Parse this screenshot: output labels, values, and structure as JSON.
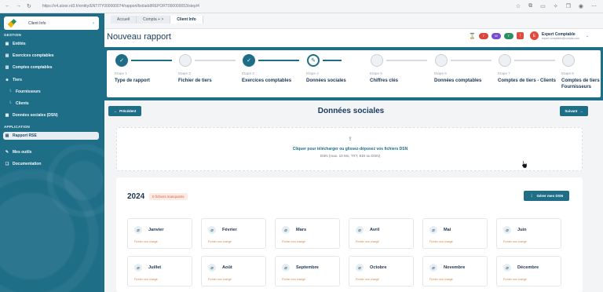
{
  "browser": {
    "url": "https://v4.atoor.rd3.fr/entity/ENTITY000000074/rapport/list/add/REPORT000000053/step/4"
  },
  "sidebar": {
    "client_label": "Client Info",
    "section_gestion": "GESTION",
    "items": [
      {
        "label": "Entités",
        "icon": "building-icon"
      },
      {
        "label": "Exercices comptables",
        "icon": "calendar-icon"
      },
      {
        "label": "Comptes comptables",
        "icon": "ledger-icon"
      },
      {
        "label": "Tiers",
        "icon": "users-icon"
      },
      {
        "label": "Fournisseurs",
        "icon": "corner-icon"
      },
      {
        "label": "Clients",
        "icon": "corner-icon"
      },
      {
        "label": "Données sociales (DSN)",
        "icon": "document-icon"
      }
    ],
    "section_application": "APPLICATION",
    "app_items": [
      {
        "label": "Rapport RSE",
        "icon": "report-icon",
        "active": true
      },
      {
        "label": "Mes outils",
        "icon": "tools-icon"
      },
      {
        "label": "Documentation",
        "icon": "book-icon"
      }
    ]
  },
  "breadcrumb": [
    "Accueil",
    "Compta + >",
    "Client Info"
  ],
  "header": {
    "title": "Nouveau rapport",
    "badges": [
      {
        "text": "7",
        "color": "#d9473a"
      },
      {
        "text": "M",
        "color": "#7a4ec9"
      },
      {
        "text": "T",
        "color": "#2f8f63"
      }
    ],
    "user_name": "Expert Comptable",
    "user_email": "expert.comptable@compta.com"
  },
  "stepper": [
    {
      "num": "Etape 1",
      "name": "Type de rapport",
      "state": "done"
    },
    {
      "num": "Etape 2",
      "name": "Fichier de tiers",
      "state": "todo"
    },
    {
      "num": "Etape 3",
      "name": "Exercices comptables",
      "state": "done"
    },
    {
      "num": "Etape 4",
      "name": "Données sociales",
      "state": "current"
    },
    {
      "num": "Etape 5",
      "name": "Chiffres clés",
      "state": "todo"
    },
    {
      "num": "Etape 6",
      "name": "Données comptables",
      "state": "todo"
    },
    {
      "num": "Etape 7",
      "name": "Comptes de tiers - Clients",
      "state": "todo"
    },
    {
      "num": "Etape 8",
      "name": "Comptes de tiers - Fournisseurs",
      "state": "todo"
    }
  ],
  "content": {
    "prev_label": "Précédent",
    "next_label": "Suivant",
    "title": "Données sociales",
    "drop_text": "Cliquer pour télécharger ou glissez-déposez vos fichiers DSN",
    "drop_sub": "DSN (max. 10 Mo, TXT, EDI ou DSN)",
    "year": "2024",
    "missing": "0 fichiers manquants",
    "manage_label": "Gérer mes DSN",
    "months": [
      {
        "name": "Janvier",
        "status": "Fichier non chargé"
      },
      {
        "name": "Février",
        "status": "Fichier non chargé"
      },
      {
        "name": "Mars",
        "status": "Fichier non chargé"
      },
      {
        "name": "Avril",
        "status": "Fichier non chargé"
      },
      {
        "name": "Mai",
        "status": "Fichier non chargé"
      },
      {
        "name": "Juin",
        "status": "Fichier non chargé"
      },
      {
        "name": "Juillet",
        "status": "Fichier non chargé"
      },
      {
        "name": "Août",
        "status": "Fichier non chargé"
      },
      {
        "name": "Septembre",
        "status": "Fichier non chargé"
      },
      {
        "name": "Octobre",
        "status": "Fichier non chargé"
      },
      {
        "name": "Novembre",
        "status": "Fichier non chargé"
      },
      {
        "name": "Décembre",
        "status": "Fichier non chargé"
      }
    ]
  }
}
